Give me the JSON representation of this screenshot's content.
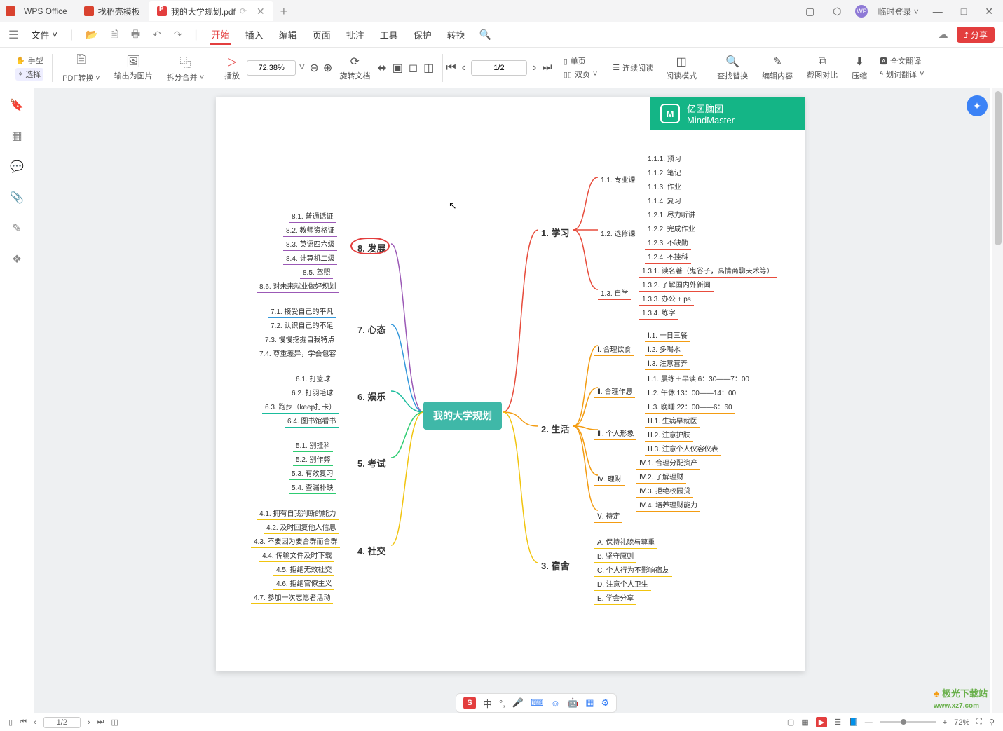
{
  "titlebar": {
    "app": "WPS Office",
    "tab_template": "找稻壳模板",
    "tab_active": "我的大学规划.pdf",
    "add": "+",
    "login": "临时登录",
    "min": "—",
    "max": "□",
    "close": "✕"
  },
  "menubar": {
    "file": "文件",
    "tabs": [
      "开始",
      "插入",
      "编辑",
      "页面",
      "批注",
      "工具",
      "保护",
      "转换"
    ],
    "share": "分享"
  },
  "ribbon": {
    "hand": "手型",
    "select": "选择",
    "pdf_convert": "PDF转换",
    "export_img": "输出为图片",
    "split_merge": "拆分合并",
    "play": "播放",
    "zoom_value": "72.38%",
    "rotate": "旋转文档",
    "single_page": "单页",
    "double_page": "双页",
    "page_indicator": "1/2",
    "continuous": "连续阅读",
    "read_mode": "阅读模式",
    "find_replace": "查找替换",
    "edit_content": "编辑内容",
    "screenshot_compare": "截图对比",
    "compress": "压缩",
    "full_translate": "全文翻译",
    "word_translate": "划词翻译"
  },
  "brand": {
    "cn": "亿图脑图",
    "en": "MindMaster",
    "logo": "M"
  },
  "center": "我的大学规划",
  "mains": {
    "m1": "1. 学习",
    "m2": "2. 生活",
    "m3": "3. 宿舍",
    "m4": "4. 社交",
    "m5": "5. 考试",
    "m6": "6. 娱乐",
    "m7": "7. 心态",
    "m8": "8. 发展"
  },
  "n": {
    "n1_1": "1.1. 专业课",
    "n1_2": "1.2. 选修课",
    "n1_3": "1.3. 自学",
    "n1_1_1": "1.1.1. 预习",
    "n1_1_2": "1.1.2. 笔记",
    "n1_1_3": "1.1.3. 作业",
    "n1_1_4": "1.1.4. 复习",
    "n1_2_1": "1.2.1. 尽力听讲",
    "n1_2_2": "1.2.2. 完成作业",
    "n1_2_3": "1.2.3. 不缺勤",
    "n1_2_4": "1.2.4. 不挂科",
    "n1_3_1": "1.3.1. 读名著（鬼谷子，高情商聊天术等）",
    "n1_3_2": "1.3.2. 了解国内外新闻",
    "n1_3_3": "1.3.3. 办公 + ps",
    "n1_3_4": "1.3.4. 练字",
    "n2_1": "Ⅰ. 合理饮食",
    "n2_2": "Ⅱ. 合理作息",
    "n2_3": "Ⅲ. 个人形象",
    "n2_4": "Ⅳ. 理财",
    "n2_5": "Ⅴ. 待定",
    "n2_1_1": "Ⅰ.1. 一日三餐",
    "n2_1_2": "Ⅰ.2. 多喝水",
    "n2_1_3": "Ⅰ.3. 注意营养",
    "n2_2_1": "Ⅱ.1. 晨练＋早读 6：30——7：00",
    "n2_2_2": "Ⅱ.2. 午休  13：00——14：00",
    "n2_2_3": "Ⅱ.3. 晚睡  22：00——6：60",
    "n2_3_1": "Ⅲ.1. 生病早就医",
    "n2_3_2": "Ⅲ.2. 注意护肤",
    "n2_3_3": "Ⅲ.3. 注意个人仪容仪表",
    "n2_4_1": "Ⅳ.1. 合理分配资产",
    "n2_4_2": "Ⅳ.2. 了解理财",
    "n2_4_3": "Ⅳ.3. 拒绝校园贷",
    "n2_4_4": "Ⅳ.4. 培养理财能力",
    "n3_a": "A. 保持礼貌与尊重",
    "n3_b": "B. 坚守原则",
    "n3_c": "C. 个人行为不影响宿友",
    "n3_d": "D. 注意个人卫生",
    "n3_e": "E. 学会分享",
    "n4_1": "4.1. 拥有自我判断的能力",
    "n4_2": "4.2. 及时回复他人信息",
    "n4_3": "4.3. 不要因为要合群而合群",
    "n4_4": "4.4. 传输文件及时下载",
    "n4_5": "4.5. 拒绝无效社交",
    "n4_6": "4.6. 拒绝官僚主义",
    "n4_7": "4.7. 参加一次志愿者活动",
    "n5_1": "5.1. 别挂科",
    "n5_2": "5.2. 别作弊",
    "n5_3": "5.3. 有效复习",
    "n5_4": "5.4. 查漏补缺",
    "n6_1": "6.1. 打篮球",
    "n6_2": "6.2. 打羽毛球",
    "n6_3": "6.3. 跑步（keep打卡）",
    "n6_4": "6.4. 图书馆看书",
    "n7_1": "7.1. 接受自己的平凡",
    "n7_2": "7.2. 认识自己的不足",
    "n7_3": "7.3. 慢慢挖掘自我特点",
    "n7_4": "7.4. 尊重差异，学会包容",
    "n8_1": "8.1. 普通话证",
    "n8_2": "8.2. 教师资格证",
    "n8_3": "8.3. 英语四六级",
    "n8_4": "8.4. 计算机二级",
    "n8_5": "8.5. 驾照",
    "n8_6": "8.6. 对未来就业做好规划"
  },
  "ime": {
    "s": "S",
    "zhong": "中"
  },
  "statusbar": {
    "page": "1/2",
    "zoom": "72%"
  },
  "watermark": {
    "t1": "极光下载站",
    "t2": "www.xz7.com"
  }
}
